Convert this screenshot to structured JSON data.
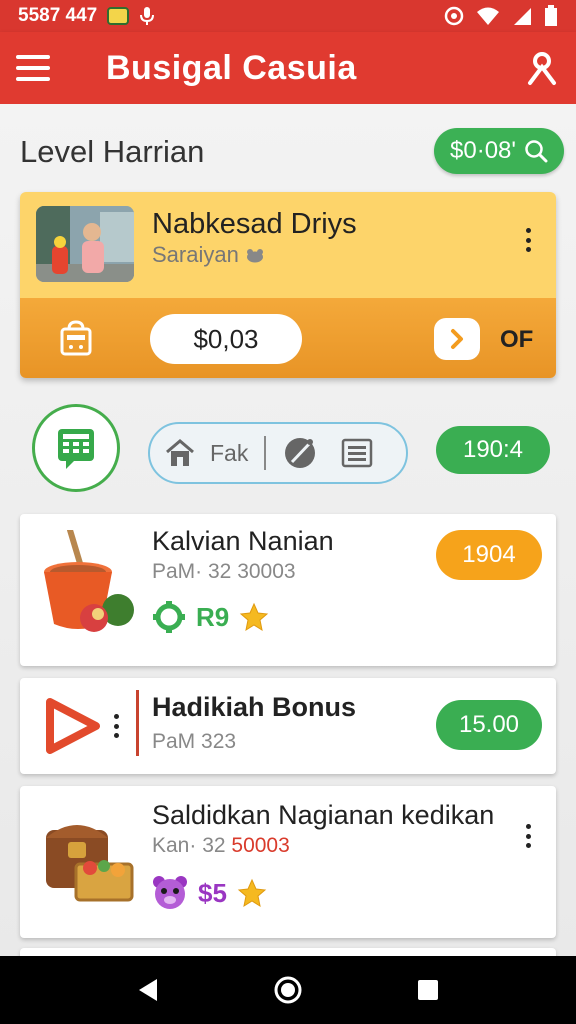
{
  "status_bar": {
    "time": "5587 447",
    "icons": [
      "app-badge-icon",
      "mic-icon",
      "at-icon",
      "wifi-icon",
      "signal-icon",
      "battery-icon"
    ]
  },
  "app_bar": {
    "title": "Busigal Casuia",
    "menu_icon": "hamburger-menu-icon",
    "user_icon": "user-icon"
  },
  "header": {
    "level_title": "Level Harrian",
    "balance": "$0·08'",
    "balance_icon": "search-icon"
  },
  "featured": {
    "name": "Nabkesad Driys",
    "subtitle": "Saraiyan",
    "subtitle_icon": "frog-icon",
    "amount": "$0,03",
    "action_label": "OF",
    "colors": {
      "top": "#fdd46a",
      "bottom": "#f4a93a"
    }
  },
  "toolbar": {
    "segment_label": "Fak",
    "counter": "190:4"
  },
  "list": [
    {
      "title": "Kalvian Nanian",
      "subtitle": "PaM· 32 30003",
      "pill": "1904",
      "reward": "R9",
      "icon": "pot-fruit-icon"
    },
    {
      "title": "Hadikiah Bonus",
      "subtitle": "PaM 323",
      "pill": "15.00",
      "icon": "play-icon"
    },
    {
      "title": "Saldidkan Nagianan kedikan",
      "subtitle_prefix": "Kan· 32 ",
      "subtitle_highlight": "50003",
      "reward": "$5",
      "icon": "treasure-chest-icon"
    }
  ],
  "nav": {
    "icons": [
      "back-icon",
      "home-icon",
      "recents-icon"
    ]
  },
  "accent_colors": {
    "red": "#e03a30",
    "green": "#3aae52",
    "orange": "#f6a31b"
  }
}
